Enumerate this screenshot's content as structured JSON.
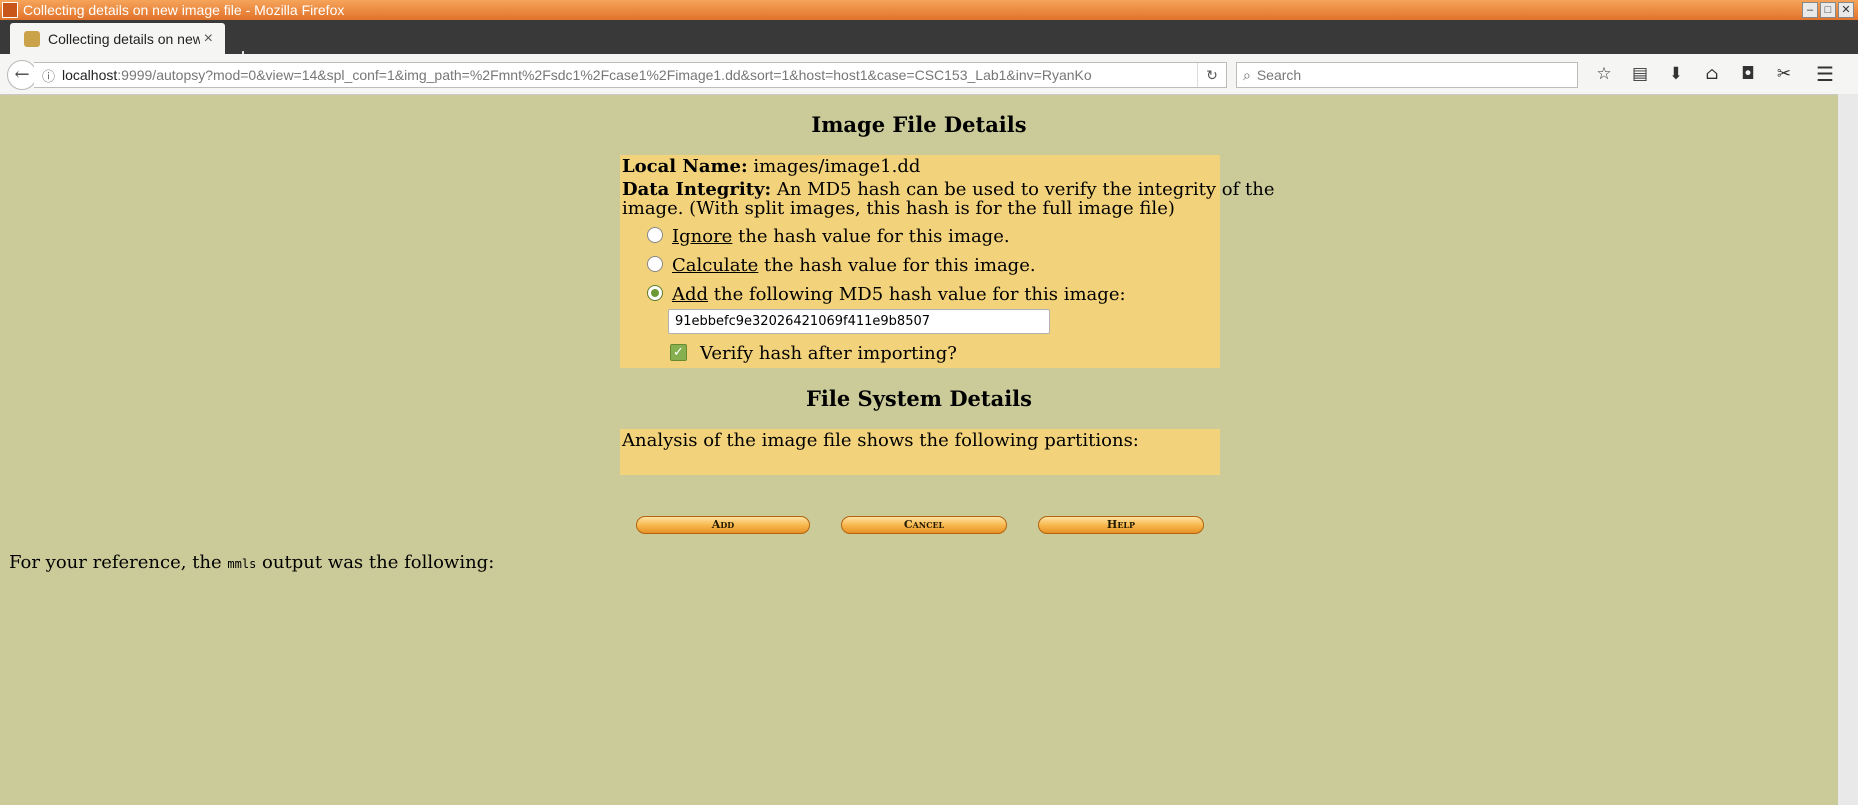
{
  "window": {
    "title": "Collecting details on new image file - Mozilla Firefox",
    "minimize": "–",
    "maximize": "□",
    "close": "✕"
  },
  "browser": {
    "tab_title": "Collecting details on new image file",
    "tab_close": "×",
    "new_tab": "+",
    "url_host": "localhost",
    "url_rest": ":9999/autopsy?mod=0&view=14&spl_conf=1&img_path=%2Fmnt%2Fsdc1%2Fcase1%2Fimage1.dd&sort=1&host=host1&case=CSC153_Lab1&inv=RyanKo",
    "search_placeholder": "Search",
    "toolbar_icons": [
      "bookmark-star-icon",
      "reading-list-icon",
      "download-icon",
      "home-icon",
      "pocket-icon",
      "extension-icon"
    ]
  },
  "page": {
    "image_details_title": "Image File Details",
    "local_name_label": "Local Name:",
    "local_name_value": "images/image1.dd",
    "integrity_label": "Data Integrity:",
    "integrity_text_1": "An MD5 hash can be used to verify the integrity of the",
    "integrity_text_2": "image. (With split images, this hash is for the full image file)",
    "option_ignore_key": "Ignore",
    "option_ignore_rest": "the hash value for this image.",
    "option_calc_key": "Calculate",
    "option_calc_rest": "the hash value for this image.",
    "option_add_key": "Add",
    "option_add_rest": "the following MD5 hash value for this image:",
    "selected_option": "add",
    "hash_value": "91ebbefc9e32026421069f411e9b8507",
    "verify_label": "Verify hash after importing?",
    "verify_checked": true,
    "fs_title": "File System Details",
    "fs_text": "Analysis of the image file shows the following partitions:",
    "btn_add": "Add",
    "btn_cancel": "Cancel",
    "btn_help": "Help",
    "ref_text_before": "For your reference, the",
    "ref_text_code": "mmls",
    "ref_text_after": "output was the following:"
  },
  "colors": {
    "page_bg": "#cbcb9a",
    "panel_bg": "#f2d27a",
    "title_bar": "#e2722a"
  }
}
